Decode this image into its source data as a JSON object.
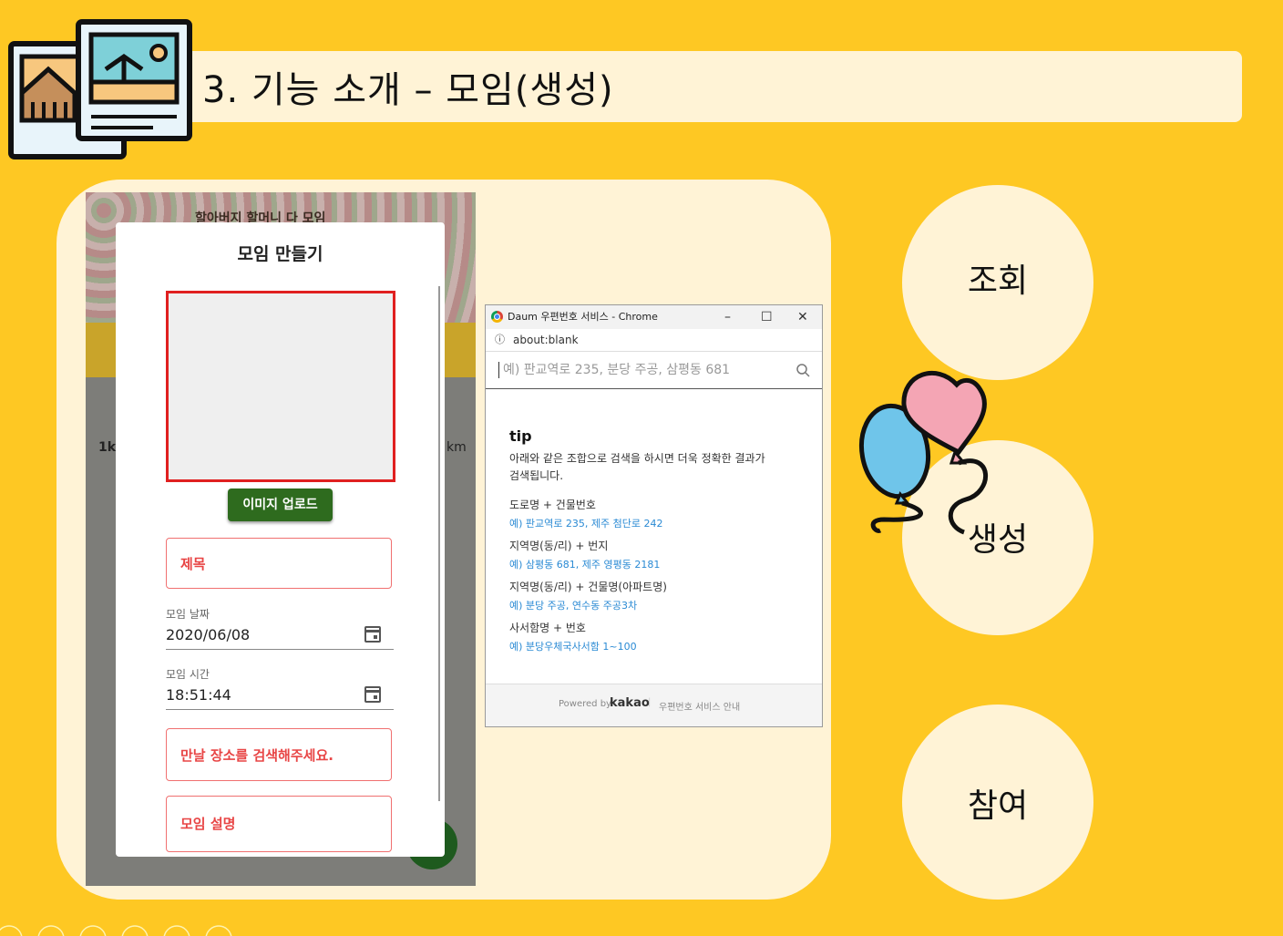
{
  "header": {
    "title": "3. 기능 소개 – 모임(생성)"
  },
  "phone": {
    "header_text": "할아버지 할머니 다 모임",
    "side_left": "1k",
    "side_right": "km",
    "modal": {
      "title": "모임 만들기",
      "upload_button": "이미지 업로드",
      "title_field": "제목",
      "date_label": "모임 날짜",
      "date_value": "2020/06/08",
      "time_label": "모임 시간",
      "time_value": "18:51:44",
      "place_field": "만날 장소를 검색해주세요.",
      "desc_field": "모임 설명"
    }
  },
  "chrome_popup": {
    "window_title": "Daum 우편번호 서비스 - Chrome",
    "address": "about:blank",
    "search_placeholder": "예) 판교역로 235, 분당 주공, 삼평동 681",
    "tip_heading": "tip",
    "tip_desc_1": "아래와 같은 조합으로 검색을 하시면 더욱 정확한 결과가",
    "tip_desc_2": "검색됩니다.",
    "rules": [
      {
        "label": "도로명 + 건물번호",
        "example": "예) 판교역로 235,  제주 첨단로 242"
      },
      {
        "label": "지역명(동/리) + 번지",
        "example": "예) 삼평동 681,  제주 영평동 2181"
      },
      {
        "label": "지역명(동/리) + 건물명(아파트명)",
        "example": "예) 분당 주공,  연수동 주공3차"
      },
      {
        "label": "사서함명 + 번호",
        "example": "예) 분당우체국사서함 1~100"
      }
    ],
    "powered_by": "Powered by",
    "brand": "kakao",
    "service_info": "우편번호 서비스 안내"
  },
  "features": [
    {
      "label": "조회"
    },
    {
      "label": "생성"
    },
    {
      "label": "참여"
    }
  ],
  "colors": {
    "background": "#fec823",
    "panel": "#fff3d6",
    "accent_green": "#2e6b1e",
    "error_red": "#e02020",
    "link_blue": "#2a8ad4"
  }
}
